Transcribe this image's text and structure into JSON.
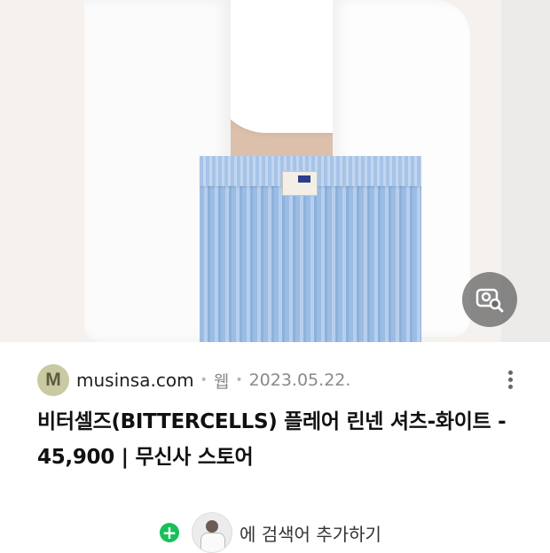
{
  "result": {
    "favicon_letter": "M",
    "domain": "musinsa.com",
    "type": "웹",
    "date": "2023.05.22.",
    "title": "비터셀즈(BITTERCELLS) 플레어 린넨 셔츠-화이트 - 45,900 | 무신사 스토어"
  },
  "suggestion": {
    "text": "에 검색어 추가하기"
  },
  "colors": {
    "accent_green": "#18c05a",
    "favicon_bg": "#c9c9a2"
  },
  "icons": {
    "lens": "image-search-icon",
    "more": "more-vertical-icon",
    "add": "plus-circle-icon"
  }
}
